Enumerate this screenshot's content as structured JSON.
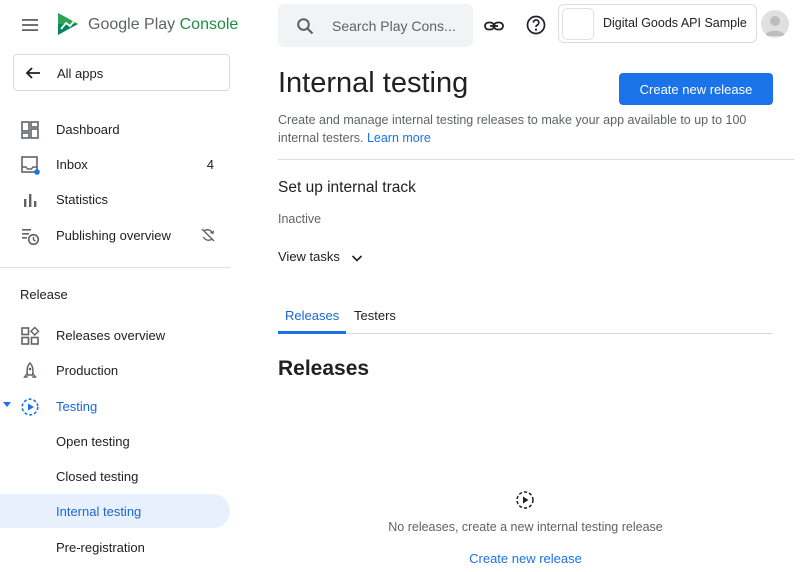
{
  "brand": {
    "google": "Google Play",
    "console": "Console"
  },
  "all_apps_label": "All apps",
  "nav": {
    "dashboard": "Dashboard",
    "inbox": "Inbox",
    "inbox_count": "4",
    "statistics": "Statistics",
    "publishing_overview": "Publishing overview",
    "release_section": "Release",
    "releases_overview": "Releases overview",
    "production": "Production",
    "testing": "Testing",
    "open_testing": "Open testing",
    "closed_testing": "Closed testing",
    "internal_testing": "Internal testing",
    "pre_registration": "Pre-registration"
  },
  "search": {
    "placeholder": "Search Play Cons..."
  },
  "app": {
    "name": "Digital Goods API Sample"
  },
  "page": {
    "title": "Internal testing",
    "create_button": "Create new release",
    "description": "Create and manage internal testing releases to make your app available to up to 100 internal testers.",
    "learn_more": "Learn more",
    "track_title": "Set up internal track",
    "status": "Inactive",
    "view_tasks": "View tasks",
    "tabs": [
      "Releases",
      "Testers"
    ],
    "releases_heading": "Releases",
    "empty_message": "No releases, create a new internal testing release",
    "empty_link": "Create new release"
  },
  "colors": {
    "accent": "#1a73e8",
    "selected_bg": "#e8f0fe",
    "console_green": "#1e8e3e"
  },
  "icons": [
    "menu-icon",
    "play-console-logo-icon",
    "back-arrow-icon",
    "dashboard-icon",
    "inbox-icon",
    "statistics-icon",
    "publishing-overview-icon",
    "sync-off-icon",
    "releases-overview-icon",
    "production-icon",
    "testing-icon",
    "search-icon",
    "link-icon",
    "help-icon",
    "avatar-icon",
    "chevron-down-icon",
    "play-circle-icon"
  ]
}
